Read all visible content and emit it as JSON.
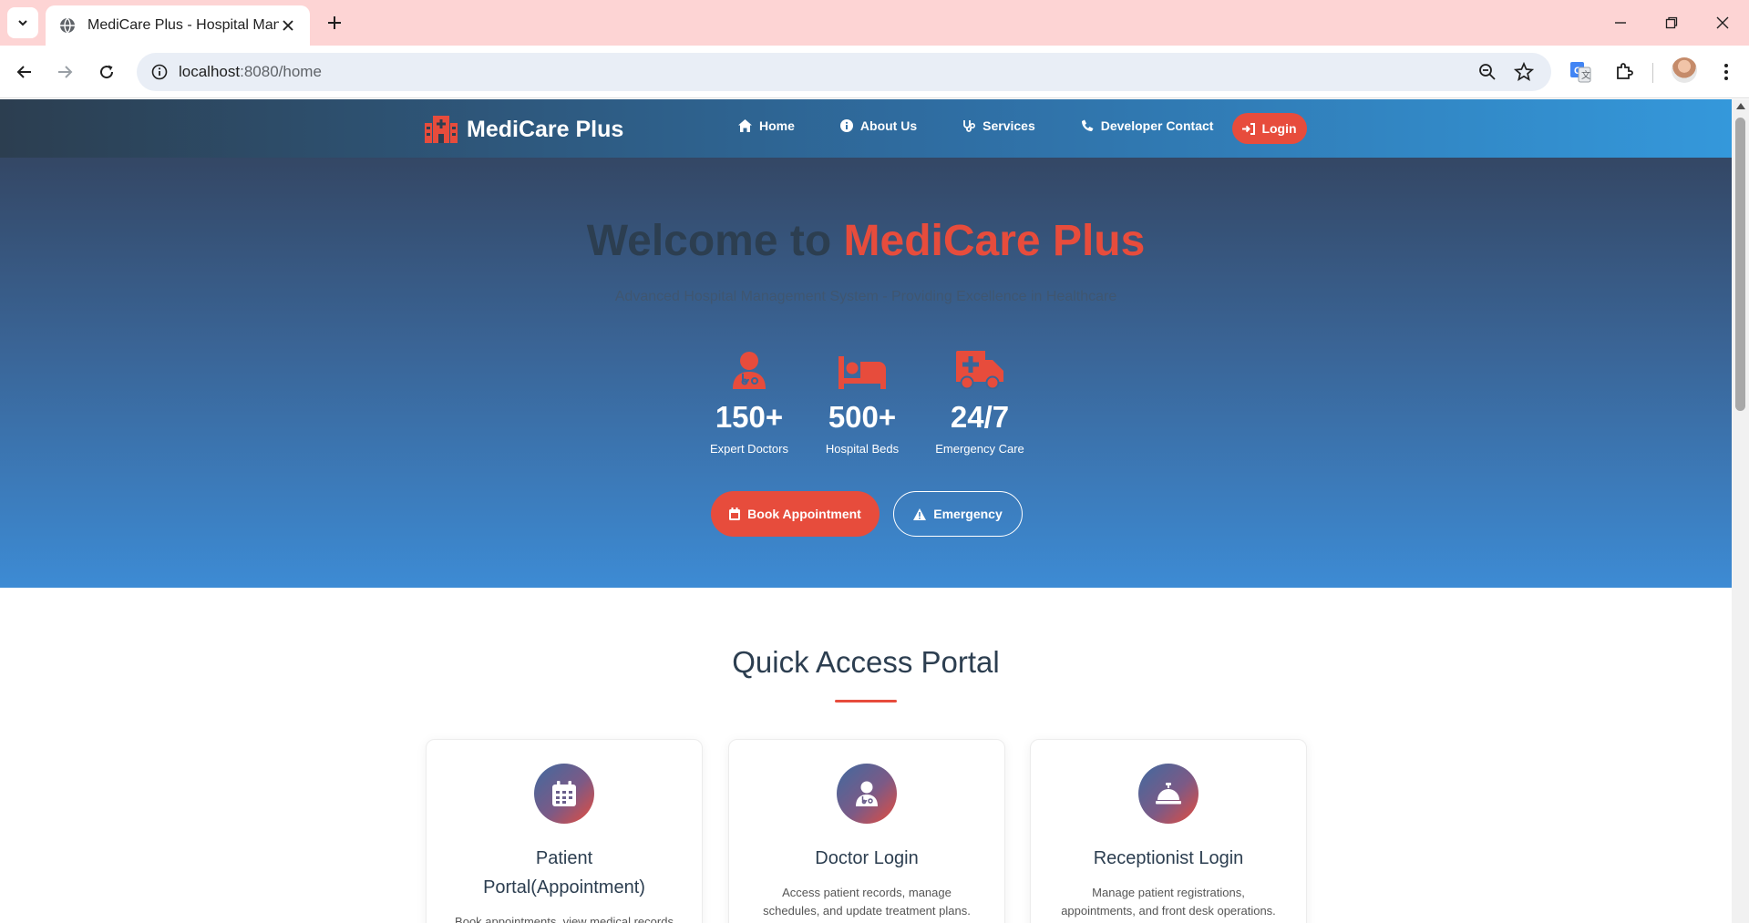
{
  "browser": {
    "tab_title": "MediCare Plus - Hospital Management System",
    "url_host": "localhost",
    "url_path": ":8080/home"
  },
  "site": {
    "brand": "MediCare Plus",
    "nav": [
      {
        "label": "Home",
        "icon": "home-icon"
      },
      {
        "label": "About Us",
        "icon": "info-icon"
      },
      {
        "label": "Services",
        "icon": "stethoscope-icon"
      },
      {
        "label": "Developer Contact",
        "icon": "phone-icon"
      }
    ],
    "login_label": "Login"
  },
  "hero": {
    "title_prefix": "Welcome to ",
    "title_accent": "MediCare Plus",
    "subtitle": "Advanced Hospital Management System - Providing Excellence in Healthcare",
    "stats": [
      {
        "value": "150+",
        "label": "Expert Doctors",
        "icon": "doctor-icon"
      },
      {
        "value": "500+",
        "label": "Hospital Beds",
        "icon": "bed-icon"
      },
      {
        "value": "24/7",
        "label": "Emergency Care",
        "icon": "ambulance-icon"
      }
    ],
    "book_label": "Book Appointment",
    "emergency_label": "Emergency"
  },
  "portal": {
    "title": "Quick Access Portal",
    "cards": [
      {
        "title": "Patient Portal(Appointment)",
        "description": "Book appointments, view medical records",
        "icon": "calendar-icon"
      },
      {
        "title": "Doctor Login",
        "description": "Access patient records, manage schedules, and update treatment plans.",
        "icon": "doctor-icon"
      },
      {
        "title": "Receptionist Login",
        "description": "Manage patient registrations, appointments, and front desk operations.",
        "icon": "concierge-bell-icon"
      }
    ]
  },
  "colors": {
    "accent": "#e74c3c",
    "dark": "#2c3e50",
    "blue": "#3498db",
    "tabbar": "#fdd4d4"
  }
}
